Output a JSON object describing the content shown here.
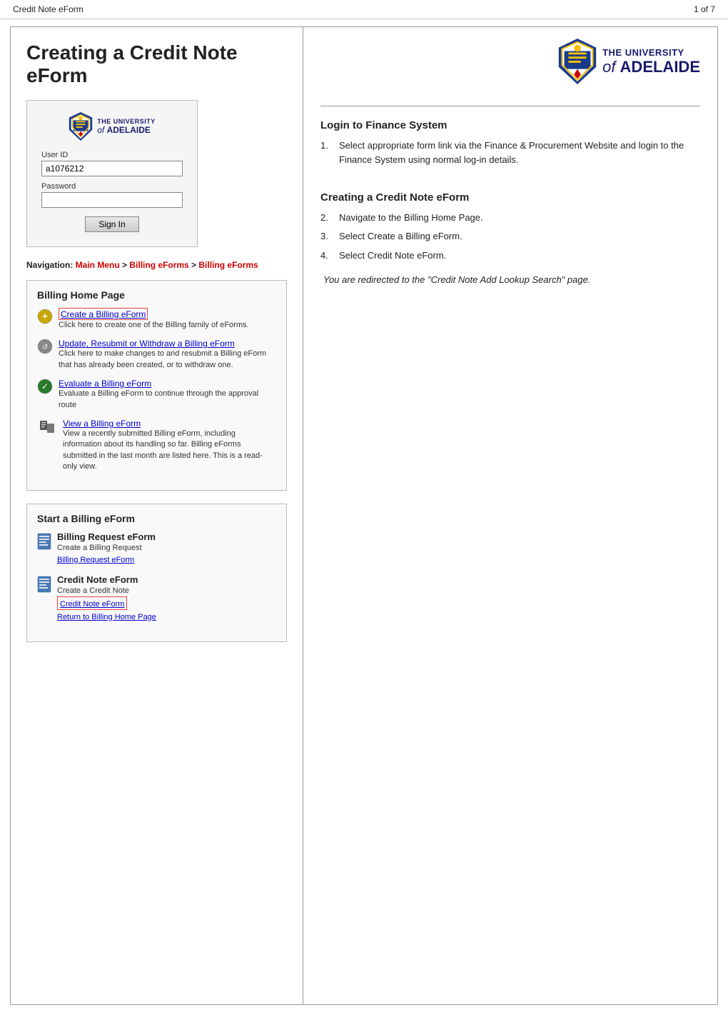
{
  "header": {
    "title": "Credit Note eForm",
    "pagination": "1 of 7"
  },
  "left": {
    "main_title": "Creating a Credit Note eForm",
    "login_box": {
      "user_id_label": "User ID",
      "user_id_value": "a1076212",
      "password_label": "Password",
      "sign_in_label": "Sign In"
    },
    "navigation": {
      "label": "Navigation:",
      "items": [
        "Main Menu",
        "Billing eForms",
        "Billing eForms"
      ]
    },
    "billing_home": {
      "title": "Billing Home Page",
      "items": [
        {
          "link": "Create a Billing eForm",
          "desc": "Click here to create one of the Billing family of eForms.",
          "highlighted": true
        },
        {
          "link": "Update, Resubmit or Withdraw a Billing eForm",
          "desc": "Click here to make changes to and resubmit a Billing eForm that has already been created, or to withdraw one.",
          "highlighted": false
        },
        {
          "link": "Evaluate a Billing eForm",
          "desc": "Evaluate a Billing eForm to continue through the approval route",
          "highlighted": false
        },
        {
          "link": "View a Billing eForm",
          "desc": "View a recently submitted Billing eForm, including information about its handling so far. Billing eForms submitted in the last month are listed here. This is a read-only view.",
          "highlighted": false
        }
      ]
    },
    "start_billing": {
      "title": "Start a Billing eForm",
      "items": [
        {
          "header": "Billing Request eForm",
          "sub": "Create a Billing Request",
          "link": "Billing Request eForm",
          "highlighted": false
        },
        {
          "header": "Credit Note eForm",
          "sub": "Create a Credit Note",
          "link": "Credit Note eForm",
          "return_link": "Return to Billing Home Page",
          "highlighted": true
        }
      ]
    }
  },
  "right": {
    "login_section": {
      "title": "Login to Finance System",
      "steps": [
        {
          "num": "1.",
          "text": "Select appropriate form link via the Finance & Procurement Website and login to the Finance System using normal log-in details."
        }
      ]
    },
    "create_section": {
      "title": "Creating a Credit Note eForm",
      "steps": [
        {
          "num": "2.",
          "text": "Navigate to the Billing Home Page."
        },
        {
          "num": "3.",
          "text": "Select Create a Billing eForm."
        },
        {
          "num": "4.",
          "text": "Select Credit Note eForm."
        }
      ],
      "italic_note": "You are redirected to the \"Credit Note Add Lookup Search\" page."
    }
  }
}
